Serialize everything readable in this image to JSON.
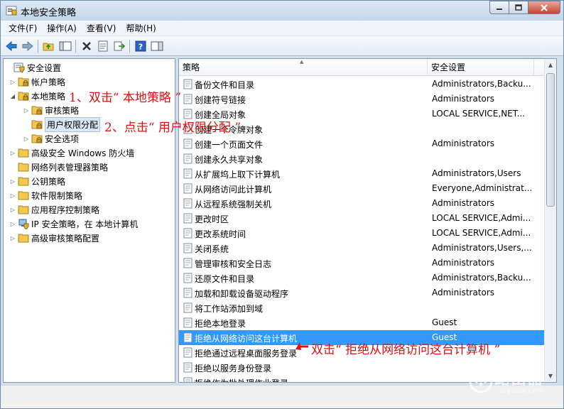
{
  "window": {
    "title": "本地安全策略"
  },
  "menu": [
    "文件(F)",
    "操作(A)",
    "查看(V)",
    "帮助(H)"
  ],
  "tree": [
    {
      "label": "安全设置",
      "level": 0,
      "arrow": "",
      "icon": "shield-settings-icon"
    },
    {
      "label": "帐户策略",
      "level": 1,
      "arrow": "▷",
      "icon": "folder-lock-icon"
    },
    {
      "label": "本地策略",
      "level": 1,
      "arrow": "◢",
      "icon": "folder-lock-icon"
    },
    {
      "label": "审核策略",
      "level": 2,
      "arrow": "▷",
      "icon": "folder-lock-icon"
    },
    {
      "label": "用户权限分配",
      "level": 2,
      "arrow": "",
      "icon": "folder-lock-icon",
      "selected": true
    },
    {
      "label": "安全选项",
      "level": 2,
      "arrow": "▷",
      "icon": "folder-lock-icon"
    },
    {
      "label": "高级安全 Windows 防火墙",
      "level": 1,
      "arrow": "▷",
      "icon": "folder-icon"
    },
    {
      "label": "网络列表管理器策略",
      "level": 1,
      "arrow": "",
      "icon": "folder-icon"
    },
    {
      "label": "公钥策略",
      "level": 1,
      "arrow": "▷",
      "icon": "folder-icon"
    },
    {
      "label": "软件限制策略",
      "level": 1,
      "arrow": "▷",
      "icon": "folder-icon"
    },
    {
      "label": "应用程序控制策略",
      "level": 1,
      "arrow": "▷",
      "icon": "folder-icon"
    },
    {
      "label": "IP 安全策略，在 本地计算机",
      "level": 1,
      "arrow": "▷",
      "icon": "ip-security-icon"
    },
    {
      "label": "高级审核策略配置",
      "level": 1,
      "arrow": "▷",
      "icon": "folder-icon"
    }
  ],
  "list": {
    "columns": [
      "策略",
      "安全设置"
    ],
    "rows": [
      {
        "name": "备份文件和目录",
        "setting": "Administrators,Backu..."
      },
      {
        "name": "创建符号链接",
        "setting": "Administrators"
      },
      {
        "name": "创建全局对象",
        "setting": "LOCAL SERVICE,NET..."
      },
      {
        "name": "创建一个令牌对象",
        "setting": ""
      },
      {
        "name": "创建一个页面文件",
        "setting": "Administrators"
      },
      {
        "name": "创建永久共享对象",
        "setting": ""
      },
      {
        "name": "从扩展坞上取下计算机",
        "setting": "Administrators,Users"
      },
      {
        "name": "从网络访问此计算机",
        "setting": "Everyone,Administrat..."
      },
      {
        "name": "从远程系统强制关机",
        "setting": "Administrators"
      },
      {
        "name": "更改时区",
        "setting": "LOCAL SERVICE,Admi..."
      },
      {
        "name": "更改系统时间",
        "setting": "LOCAL SERVICE,Admi..."
      },
      {
        "name": "关闭系统",
        "setting": "Administrators,Users,..."
      },
      {
        "name": "管理审核和安全日志",
        "setting": "Administrators"
      },
      {
        "name": "还原文件和目录",
        "setting": "Administrators,Backu..."
      },
      {
        "name": "加载和卸载设备驱动程序",
        "setting": "Administrators"
      },
      {
        "name": "将工作站添加到域",
        "setting": ""
      },
      {
        "name": "拒绝本地登录",
        "setting": "Guest"
      },
      {
        "name": "拒绝从网络访问这台计算机",
        "setting": "Guest",
        "selected": true
      },
      {
        "name": "拒绝通过远程桌面服务登录",
        "setting": ""
      },
      {
        "name": "拒绝以服务身份登录",
        "setting": ""
      },
      {
        "name": "拒绝作为批处理作业登录",
        "setting": ""
      }
    ]
  },
  "annotations": {
    "step1": "1、双击“ 本地策略 ”",
    "step2": "2、点击“ 用户权限分配 ”",
    "step3": "双击“ 拒绝从网络访问这台计算机 ”"
  },
  "watermark": {
    "text": "路由器",
    "sub": "luyouqi.com"
  },
  "colors": {
    "selection": "#3399ff",
    "annotation": "#e01010"
  }
}
